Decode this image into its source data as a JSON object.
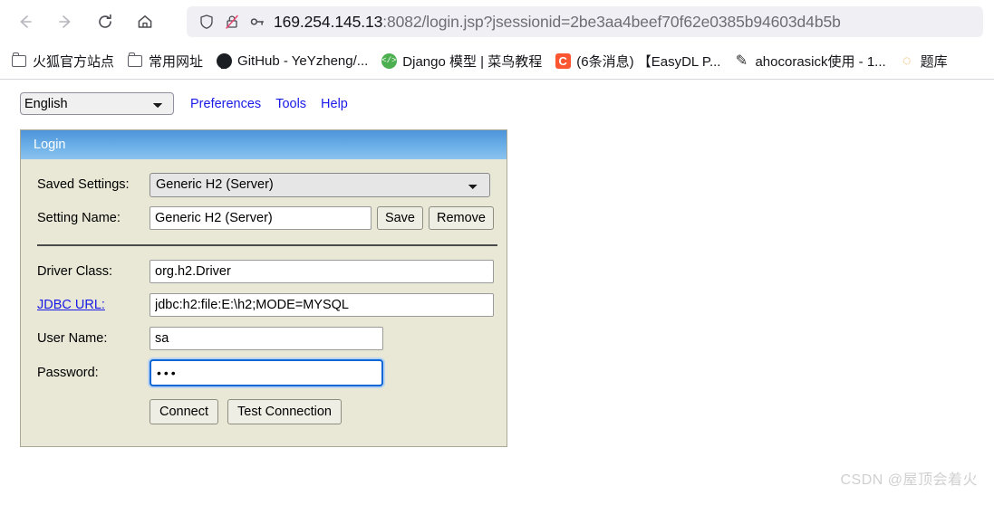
{
  "browser": {
    "nav": {
      "back": "back-arrow",
      "forward": "forward-arrow",
      "reload": "reload",
      "home": "home"
    },
    "url": {
      "host": "169.254.145.13",
      "rest": ":8082/login.jsp?jsessionid=2be3aa4beef70f62e0385b94603d4b5b",
      "icons": [
        "shield-icon",
        "lock-crossed-icon",
        "key-icon"
      ]
    },
    "bookmarks": [
      {
        "label": "火狐官方站点",
        "icon": "folder-icon"
      },
      {
        "label": "常用网址",
        "icon": "folder-icon"
      },
      {
        "label": "GitHub - YeYzheng/...",
        "icon": "github-icon"
      },
      {
        "label": "Django 模型 | 菜鸟教程",
        "icon": "django-icon"
      },
      {
        "label": "(6条消息) 【EasyDL P...",
        "icon": "csdn-icon"
      },
      {
        "label": "ahocorasick使用 - 1...",
        "icon": "cnblogs-icon"
      },
      {
        "label": "题库",
        "icon": "tiku-icon"
      }
    ]
  },
  "page": {
    "language": {
      "selected": "English",
      "options": [
        "English"
      ]
    },
    "menu": [
      {
        "label": "Preferences"
      },
      {
        "label": "Tools"
      },
      {
        "label": "Help"
      }
    ],
    "panel": {
      "title": "Login",
      "fields": {
        "saved_settings_label": "Saved Settings:",
        "saved_settings_value": "Generic H2 (Server)",
        "saved_settings_options": [
          "Generic H2 (Server)"
        ],
        "setting_name_label": "Setting Name:",
        "setting_name_value": "Generic H2 (Server)",
        "save_label": "Save",
        "remove_label": "Remove",
        "driver_class_label": "Driver Class:",
        "driver_class_value": "org.h2.Driver",
        "jdbc_url_label": "JDBC URL:",
        "jdbc_url_value": "jdbc:h2:file:E:\\h2;MODE=MYSQL",
        "user_name_label": "User Name:",
        "user_name_value": "sa",
        "password_label": "Password:",
        "password_value": "•••",
        "connect_label": "Connect",
        "test_connection_label": "Test Connection"
      }
    },
    "watermark": "CSDN @屋顶会着火"
  },
  "colors": {
    "panel_header_blue": "#6cb0e8",
    "panel_body_cream": "#e9e7d5",
    "link_blue": "#1a1ae6",
    "focus_blue": "#0a65d6"
  }
}
